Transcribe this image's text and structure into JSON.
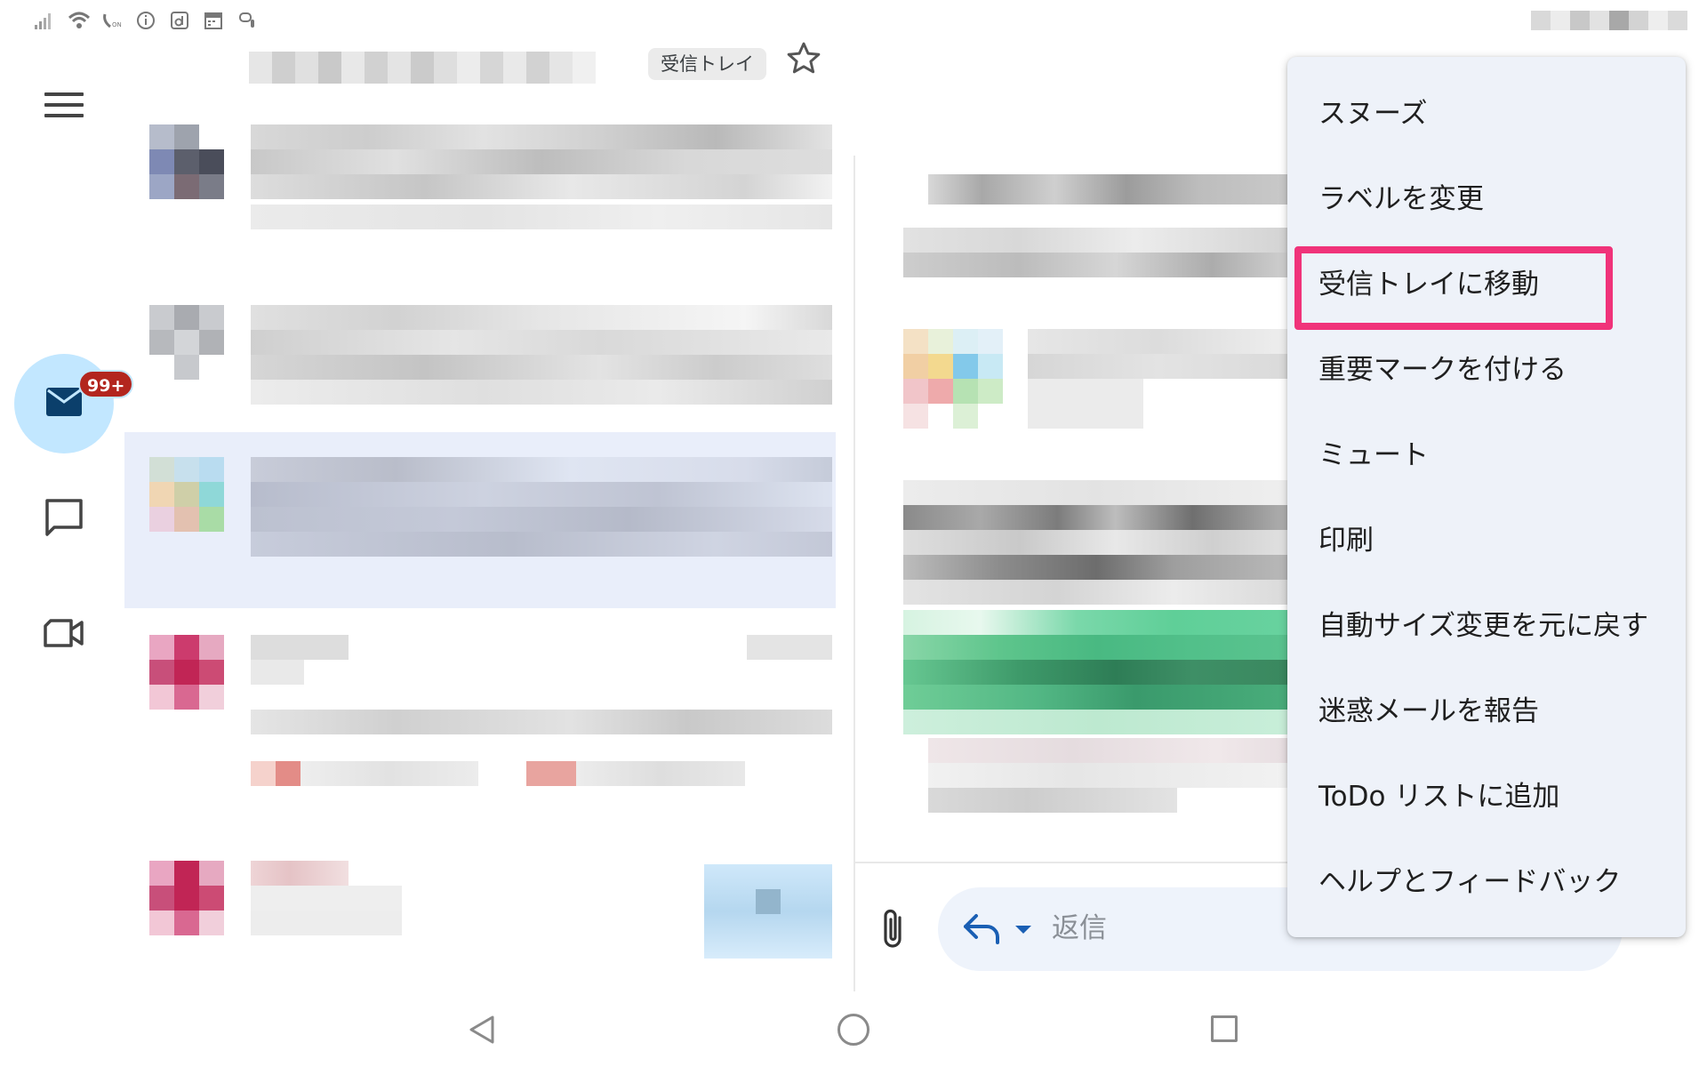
{
  "status_bar": {
    "icons": [
      "signal-icon",
      "wifi-icon",
      "volte-icon",
      "info-icon",
      "d-app-icon",
      "calendar-icon",
      "mic-icon"
    ]
  },
  "thread_header": {
    "label_chip": "受信トレイ",
    "star_icon": "star-outline-icon"
  },
  "rail": {
    "menu_icon": "hamburger-icon",
    "mail_badge": "99+",
    "items": [
      "mail-icon",
      "chat-icon",
      "meet-icon"
    ]
  },
  "reply": {
    "placeholder": "返信",
    "attach_icon": "paperclip-icon",
    "reply_icon": "reply-icon"
  },
  "menu": {
    "items": [
      "スヌーズ",
      "ラベルを変更",
      "受信トレイに移動",
      "重要マークを付ける",
      "ミュート",
      "印刷",
      "自動サイズ変更を元に戻す",
      "迷惑メールを報告",
      "ToDo リストに追加",
      "ヘルプとフィードバック"
    ],
    "highlighted_index": 2,
    "highlight_color": "#f0337a"
  },
  "nav": {
    "buttons": [
      "back-icon",
      "home-icon",
      "recents-icon"
    ]
  },
  "colors": {
    "accent_mail": "#c2e7ff",
    "badge": "#b3261e",
    "reply_icon": "#1a5fb4"
  }
}
